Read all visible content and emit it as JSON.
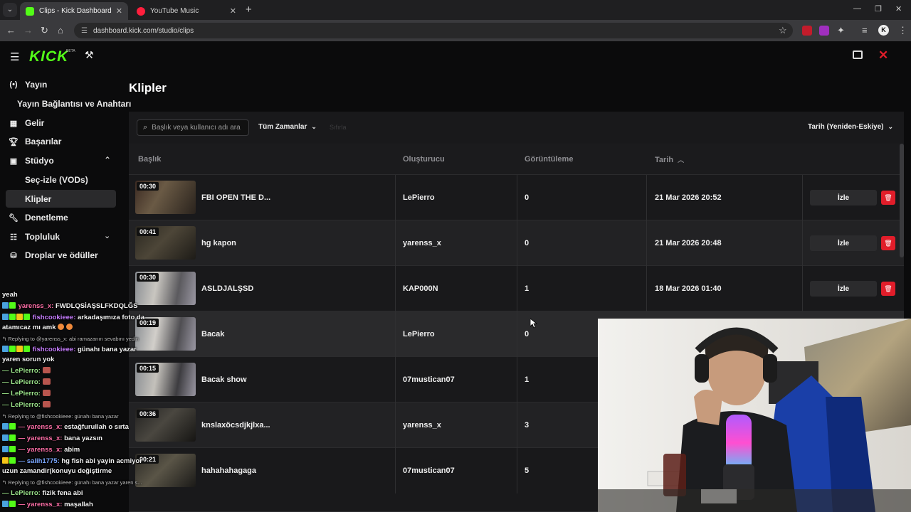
{
  "browser": {
    "tabs": [
      {
        "title": "Clips - Kick Dashboard",
        "active": true
      },
      {
        "title": "YouTube Music",
        "active": false
      }
    ],
    "url": "dashboard.kick.com/studio/clips"
  },
  "header": {
    "logo": "KICK",
    "logo_badge": "BETA"
  },
  "sidebar": {
    "items": [
      {
        "label": "Yayın",
        "icon": "broadcast-icon"
      },
      {
        "label": "Yayın Bağlantısı ve Anahtarı",
        "icon": ""
      },
      {
        "label": "Gelir",
        "icon": "revenue-icon"
      },
      {
        "label": "Başarılar",
        "icon": "trophy-icon"
      },
      {
        "label": "Stüdyo",
        "icon": "studio-icon"
      },
      {
        "label": "Seç-izle (VODs)",
        "icon": ""
      },
      {
        "label": "Klipler",
        "icon": ""
      },
      {
        "label": "Denetleme",
        "icon": "wrench-icon"
      },
      {
        "label": "Topluluk",
        "icon": "community-icon"
      },
      {
        "label": "Droplar ve ödüller",
        "icon": "drops-icon"
      }
    ]
  },
  "main": {
    "title": "Klipler",
    "search_placeholder": "Başlık veya kullanıcı adı ara",
    "time_filter": "Tüm Zamanlar",
    "clear_label": "Sıfırla",
    "sort_label": "Tarih (Yeniden-Eskiye)",
    "columns": [
      "Başlık",
      "Oluşturucu",
      "Görüntüleme",
      "Tarih"
    ],
    "watch_label": "İzle",
    "rows": [
      {
        "duration": "00:30",
        "title": "FBI OPEN THE D...",
        "creator": "LePierro",
        "views": "0",
        "date": "21 Mar 2026 20:52"
      },
      {
        "duration": "00:41",
        "title": "hg kapon",
        "creator": "yarenss_x",
        "views": "0",
        "date": "21 Mar 2026 20:48"
      },
      {
        "duration": "00:30",
        "title": "ASLDJALŞSD",
        "creator": "KAP000N",
        "views": "1",
        "date": "18 Mar 2026 01:40"
      },
      {
        "duration": "00:19",
        "title": "Bacak",
        "creator": "LePierro",
        "views": "0",
        "date": ""
      },
      {
        "duration": "00:15",
        "title": "Bacak show",
        "creator": "07mustican07",
        "views": "1",
        "date": ""
      },
      {
        "duration": "00:36",
        "title": "knslaxöcsdjkjlxa...",
        "creator": "yarenss_x",
        "views": "3",
        "date": ""
      },
      {
        "duration": "00:21",
        "title": "hahahahagaga",
        "creator": "07mustican07",
        "views": "5",
        "date": ""
      }
    ]
  },
  "chat": {
    "lines": [
      {
        "user": "",
        "text": "yeah",
        "color": "#f2f2f2"
      },
      {
        "user": "yarenss_x:",
        "text": "FWDLQSİAŞSLFKDQLĞS",
        "color": "#ff6fa8"
      },
      {
        "user": "fishcookieee:",
        "text": "arkadaşımıza foto da",
        "color": "#c77dff"
      },
      {
        "user": "",
        "text": "atamıcaz mı amk",
        "color": "#f2f2f2"
      },
      {
        "user": "",
        "text": "Replying to @yarenss_x: abi ramazanın sevabını yedin",
        "color": "#bcbcbc"
      },
      {
        "user": "fishcookieee:",
        "text": "günahı bana yazar",
        "color": "#c77dff"
      },
      {
        "user": "",
        "text": "yaren sorun yok",
        "color": "#f2f2f2"
      },
      {
        "user": "LePierro:",
        "text": "",
        "color": "#9be38a"
      },
      {
        "user": "LePierro:",
        "text": "",
        "color": "#9be38a"
      },
      {
        "user": "LePierro:",
        "text": "",
        "color": "#9be38a"
      },
      {
        "user": "LePierro:",
        "text": "",
        "color": "#9be38a"
      },
      {
        "user": "",
        "text": "Replying to @fishcookieee: günahı bana yazar",
        "color": "#bcbcbc"
      },
      {
        "user": "yarenss_x:",
        "text": "estağfurullah o sırta",
        "color": "#ff6fa8"
      },
      {
        "user": "yarenss_x:",
        "text": "bana yazsın",
        "color": "#ff6fa8"
      },
      {
        "user": "yarenss_x:",
        "text": "abim",
        "color": "#ff6fa8"
      },
      {
        "user": "salih1775:",
        "text": "hg fish abi yayin acmiyor",
        "color": "#7aa7ff"
      },
      {
        "user": "",
        "text": "uzun zamandir(konuyu değiştirme",
        "color": "#f2f2f2"
      },
      {
        "user": "",
        "text": "Replying to @fishcookieee: günahı bana yazar yaren s...",
        "color": "#bcbcbc"
      },
      {
        "user": "LePierro:",
        "text": "fizik fena abi",
        "color": "#9be38a"
      },
      {
        "user": "yarenss_x:",
        "text": "maşallah",
        "color": "#ff6fa8"
      }
    ]
  },
  "colors": {
    "kick_green": "#53fc18",
    "delete_red": "#e11d2a",
    "bg": "#0b0b0c",
    "panel": "#19191b"
  }
}
